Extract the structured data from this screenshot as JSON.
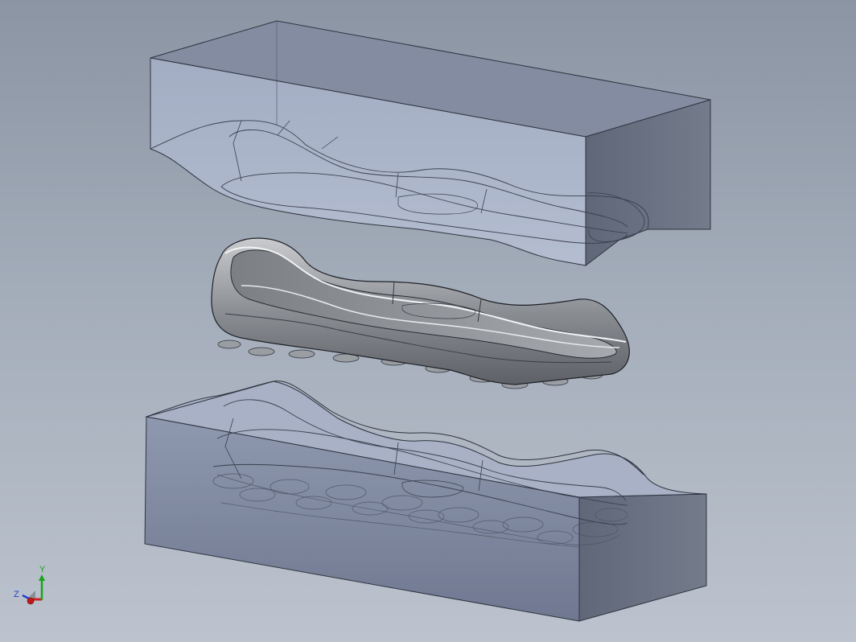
{
  "viewport": {
    "description_colors": {
      "background_top": "#8b95a3",
      "background_bottom": "#bcc3ce",
      "mold_fill": "#a7b2c8",
      "mold_side": "#6e7686",
      "edge": "#2f3440",
      "sole": "#8d8f93"
    }
  },
  "model": {
    "parts": [
      {
        "id": "upper-mold",
        "label": "upper-mold-block"
      },
      {
        "id": "shoe-sole",
        "label": "shoe-sole"
      },
      {
        "id": "lower-mold",
        "label": "lower-mold-block"
      }
    ]
  },
  "triad": {
    "x_label": "X",
    "y_label": "Y",
    "z_label": "Z",
    "x_color": "#d02020",
    "y_color": "#1aa51a",
    "z_color": "#2040d0"
  }
}
